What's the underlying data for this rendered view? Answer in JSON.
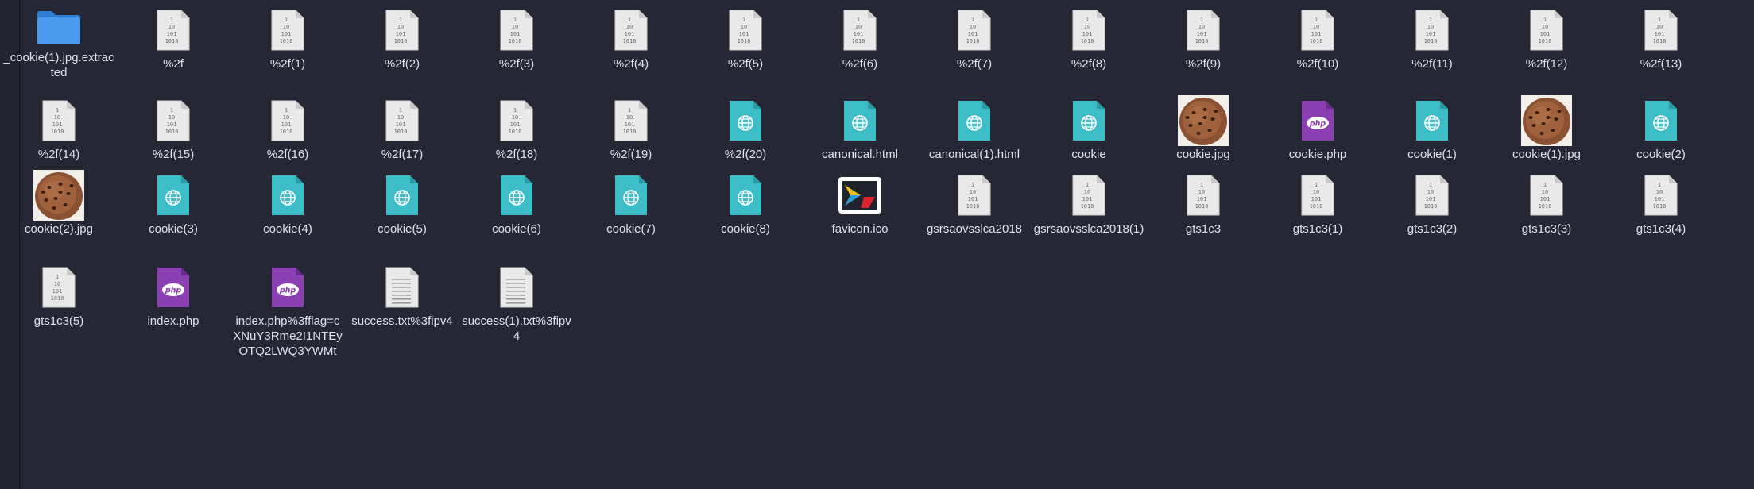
{
  "window": {
    "view": "file-manager-icon-grid"
  },
  "colors": {
    "background": "#252834",
    "text": "#dfe2e8",
    "folder": "#3d8fe8",
    "html_file": "#3dbdc8",
    "php_file": "#8a3fb3",
    "generic_file": "#e6e6e6"
  },
  "files": [
    {
      "name": "_cookie(1).jpg.extracted",
      "icon": "folder-icon"
    },
    {
      "name": "%2f",
      "icon": "binary-file-icon"
    },
    {
      "name": "%2f(1)",
      "icon": "binary-file-icon"
    },
    {
      "name": "%2f(2)",
      "icon": "binary-file-icon"
    },
    {
      "name": "%2f(3)",
      "icon": "binary-file-icon"
    },
    {
      "name": "%2f(4)",
      "icon": "binary-file-icon"
    },
    {
      "name": "%2f(5)",
      "icon": "binary-file-icon"
    },
    {
      "name": "%2f(6)",
      "icon": "binary-file-icon"
    },
    {
      "name": "%2f(7)",
      "icon": "binary-file-icon"
    },
    {
      "name": "%2f(8)",
      "icon": "binary-file-icon"
    },
    {
      "name": "%2f(9)",
      "icon": "binary-file-icon"
    },
    {
      "name": "%2f(10)",
      "icon": "binary-file-icon"
    },
    {
      "name": "%2f(11)",
      "icon": "binary-file-icon"
    },
    {
      "name": "%2f(12)",
      "icon": "binary-file-icon"
    },
    {
      "name": "%2f(13)",
      "icon": "binary-file-icon"
    },
    {
      "name": "%2f(14)",
      "icon": "binary-file-icon"
    },
    {
      "name": "%2f(15)",
      "icon": "binary-file-icon"
    },
    {
      "name": "%2f(16)",
      "icon": "binary-file-icon"
    },
    {
      "name": "%2f(17)",
      "icon": "binary-file-icon"
    },
    {
      "name": "%2f(18)",
      "icon": "binary-file-icon"
    },
    {
      "name": "%2f(19)",
      "icon": "binary-file-icon"
    },
    {
      "name": "%2f(20)",
      "icon": "html-file-icon"
    },
    {
      "name": "canonical.html",
      "icon": "html-file-icon"
    },
    {
      "name": "canonical(1).html",
      "icon": "html-file-icon"
    },
    {
      "name": "cookie",
      "icon": "html-file-icon"
    },
    {
      "name": "cookie.jpg",
      "icon": "cookie-image-thumbnail"
    },
    {
      "name": "cookie.php",
      "icon": "php-file-icon"
    },
    {
      "name": "cookie(1)",
      "icon": "html-file-icon"
    },
    {
      "name": "cookie(1).jpg",
      "icon": "cookie-image-thumbnail"
    },
    {
      "name": "cookie(2)",
      "icon": "html-file-icon"
    },
    {
      "name": "cookie(2).jpg",
      "icon": "cookie-image-thumbnail"
    },
    {
      "name": "cookie(3)",
      "icon": "html-file-icon"
    },
    {
      "name": "cookie(4)",
      "icon": "html-file-icon"
    },
    {
      "name": "cookie(5)",
      "icon": "html-file-icon"
    },
    {
      "name": "cookie(6)",
      "icon": "html-file-icon"
    },
    {
      "name": "cookie(7)",
      "icon": "html-file-icon"
    },
    {
      "name": "cookie(8)",
      "icon": "html-file-icon"
    },
    {
      "name": "favicon.ico",
      "icon": "favicon-image-icon"
    },
    {
      "name": "gsrsaovsslca2018",
      "icon": "binary-file-icon"
    },
    {
      "name": "gsrsaovsslca2018(1)",
      "icon": "binary-file-icon"
    },
    {
      "name": "gts1c3",
      "icon": "binary-file-icon"
    },
    {
      "name": "gts1c3(1)",
      "icon": "binary-file-icon"
    },
    {
      "name": "gts1c3(2)",
      "icon": "binary-file-icon"
    },
    {
      "name": "gts1c3(3)",
      "icon": "binary-file-icon"
    },
    {
      "name": "gts1c3(4)",
      "icon": "binary-file-icon"
    },
    {
      "name": "gts1c3(5)",
      "icon": "binary-file-icon"
    },
    {
      "name": "index.php",
      "icon": "php-file-icon"
    },
    {
      "name": "index.php%3fflag=cXNuY3Rme2I1NTEyOTQ2LWQ3YWMt",
      "icon": "php-file-icon"
    },
    {
      "name": "success.txt%3fipv4",
      "icon": "text-file-icon"
    },
    {
      "name": "success(1).txt%3fipv4",
      "icon": "text-file-icon"
    }
  ]
}
